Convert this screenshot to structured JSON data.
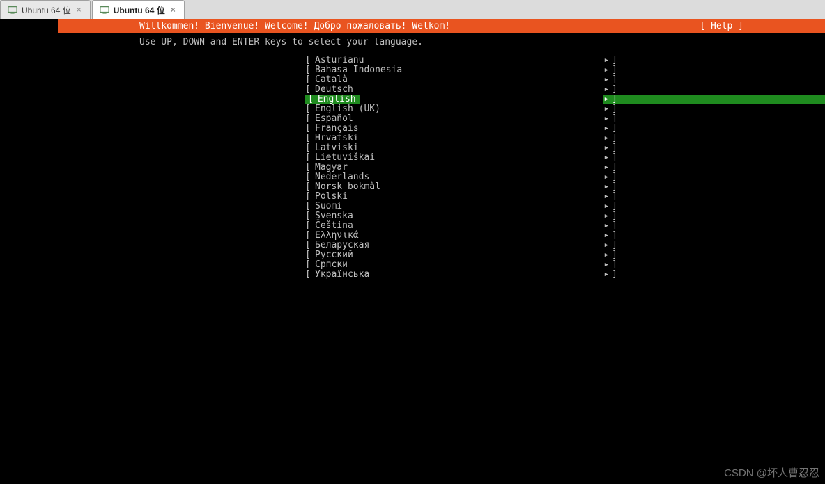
{
  "tabs": [
    {
      "label": "Ubuntu 64 位",
      "active": false
    },
    {
      "label": "Ubuntu 64 位",
      "active": true
    }
  ],
  "header": {
    "title": "Willkommen! Bienvenue! Welcome! Добро пожаловать! Welkom!",
    "help": "[ Help ]"
  },
  "instruction": "Use UP, DOWN and ENTER keys to select your language.",
  "bracket_left": "[",
  "bracket_right": "]",
  "arrow_glyph": "▸",
  "selected_index": 4,
  "languages": [
    "Asturianu",
    "Bahasa Indonesia",
    "Català",
    "Deutsch",
    "English",
    "English (UK)",
    "Español",
    "Français",
    "Hrvatski",
    "Latviski",
    "Lietuviškai",
    "Magyar",
    "Nederlands",
    "Norsk bokmål",
    "Polski",
    "Suomi",
    "Svenska",
    "Čeština",
    "Ελληνικά",
    "Беларуская",
    "Русский",
    "Српски",
    "Українська"
  ],
  "watermark": "CSDN @坏人曹忍忍"
}
